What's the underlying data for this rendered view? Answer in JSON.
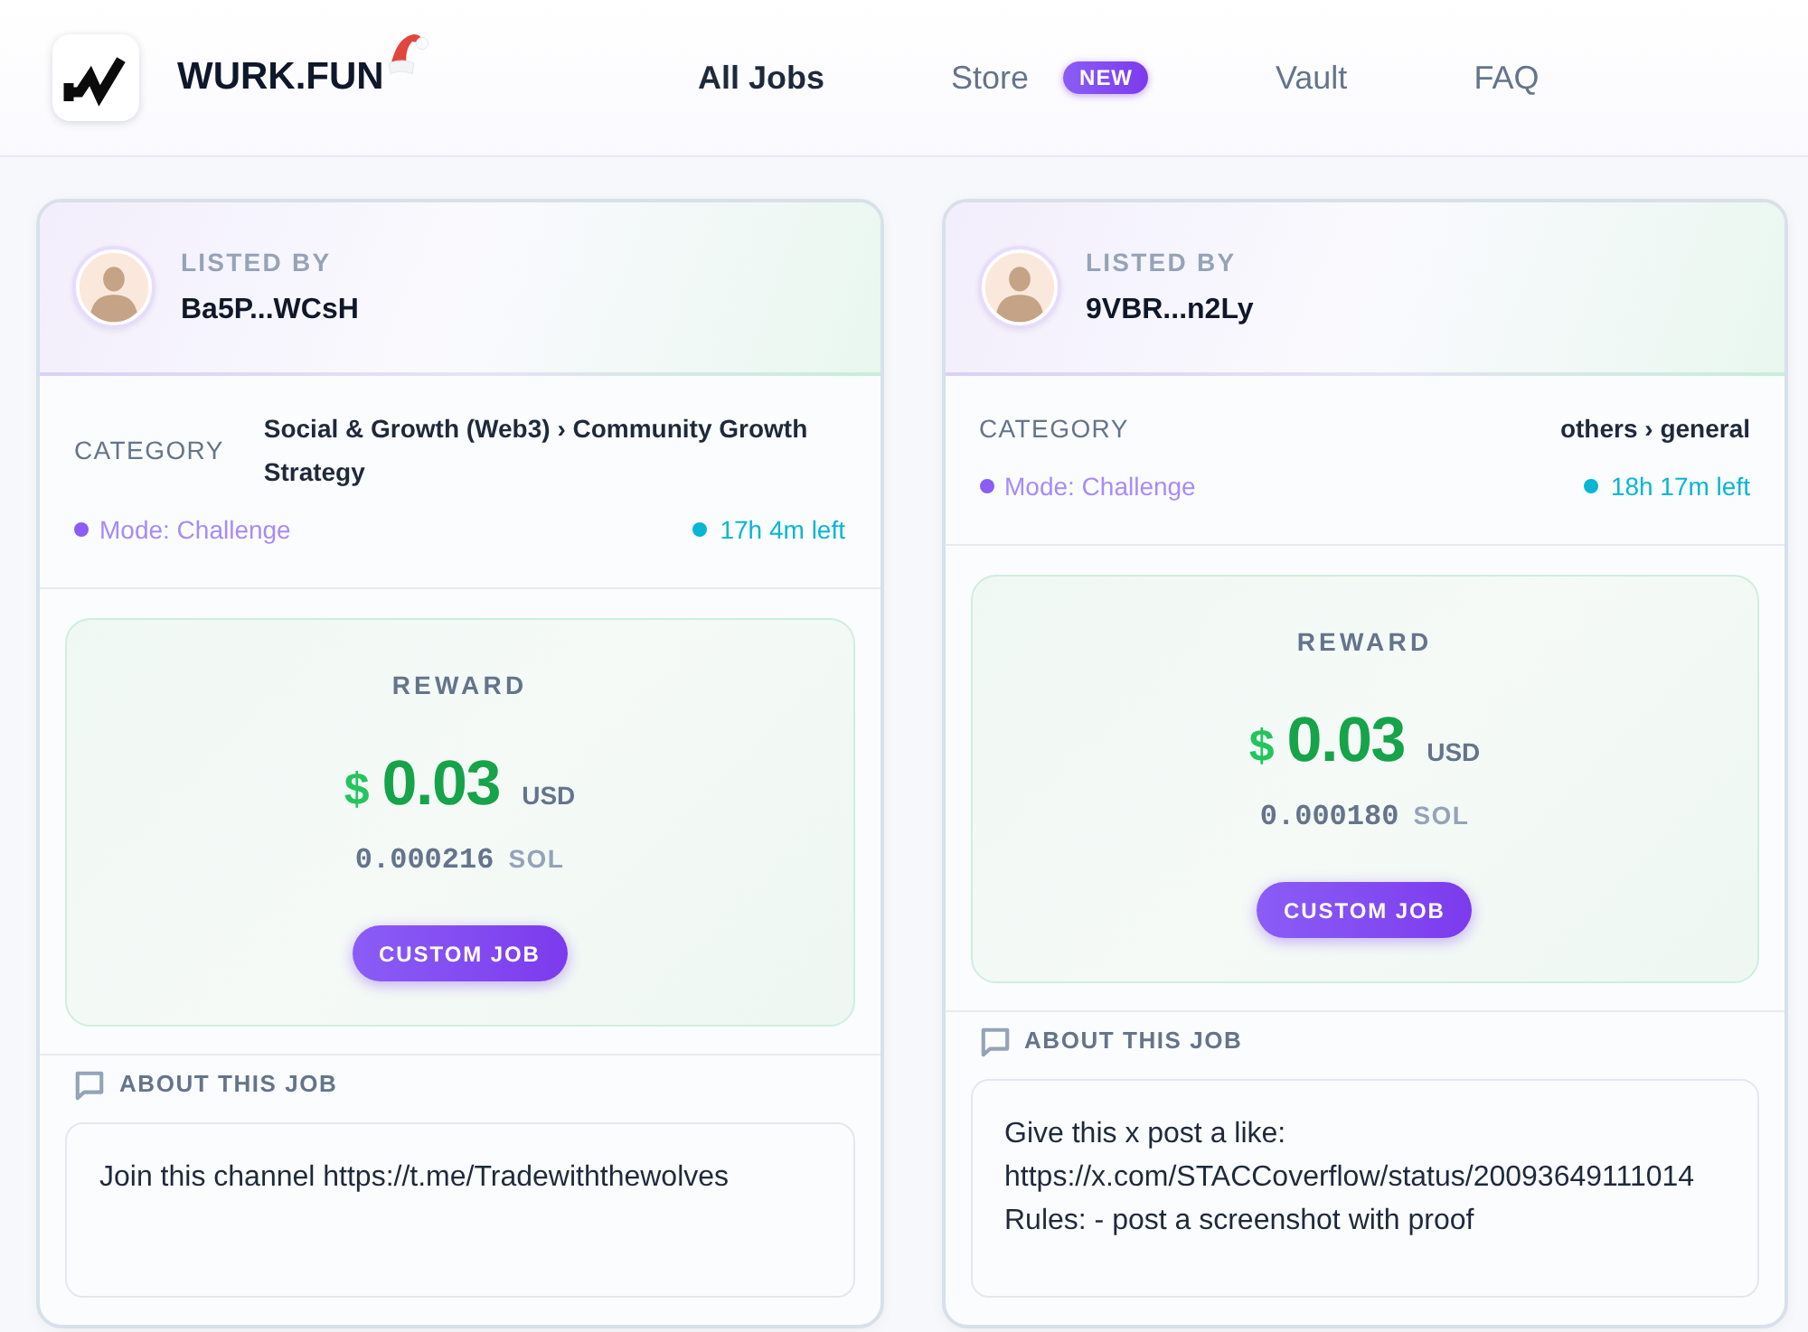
{
  "header": {
    "brand": "WURK.FUN",
    "nav": [
      {
        "label": "All Jobs",
        "selected": true
      },
      {
        "label": "Store",
        "selected": false,
        "badge": "NEW"
      },
      {
        "label": "Vault",
        "selected": false
      },
      {
        "label": "FAQ",
        "selected": false
      }
    ]
  },
  "jobs": [
    {
      "listed_by_label": "LISTED BY",
      "lister": "Ba5P...WCsH",
      "category_label": "CATEGORY",
      "category": "Social & Growth (Web3) › Community Growth Strategy",
      "mode": "Mode: Challenge",
      "time_left": "17h 4m left",
      "reward_label": "REWARD",
      "currency_symbol": "$",
      "usd_amount": "0.03",
      "usd_unit": "USD",
      "sol_amount": "0.000216",
      "sol_unit": "SOL",
      "action": "CUSTOM JOB",
      "about_label": "ABOUT THIS JOB",
      "description": "Join this channel https://t.me/Tradewiththewolves"
    },
    {
      "listed_by_label": "LISTED BY",
      "lister": "9VBR...n2Ly",
      "category_label": "CATEGORY",
      "category": "others › general",
      "mode": "Mode: Challenge",
      "time_left": "18h 17m left",
      "reward_label": "REWARD",
      "currency_symbol": "$",
      "usd_amount": "0.03",
      "usd_unit": "USD",
      "sol_amount": "0.000180",
      "sol_unit": "SOL",
      "action": "CUSTOM JOB",
      "about_label": "ABOUT THIS JOB",
      "description": "Give this x post a like:\nhttps://x.com/STACCoverflow/status/20093649111014\nRules: - post a screenshot with proof"
    }
  ]
}
